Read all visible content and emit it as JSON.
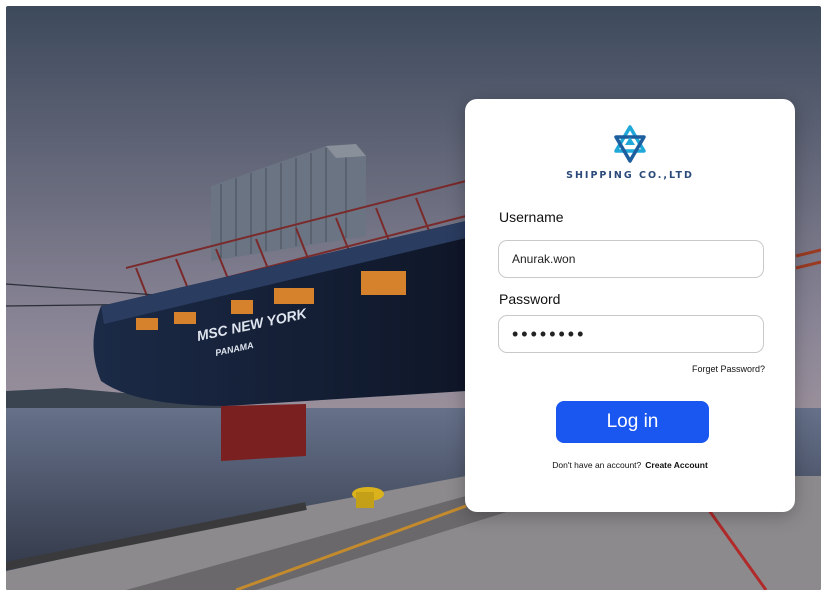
{
  "ship": {
    "name": "MSC NEW YORK",
    "port": "PANAMA"
  },
  "login": {
    "brand_name": "SHIPPING CO.,LTD",
    "username_label": "Username",
    "username_value": "Anurak.won",
    "password_label": "Password",
    "password_value": "••••••••",
    "forgot_label": "Forget Password?",
    "login_label": "Log in",
    "signup_prompt": "Don't have an account?",
    "create_account_label": "Create Account"
  },
  "colors": {
    "accent": "#1a56f0",
    "logo": "#1fa8d8",
    "brand": "#2b4a7a"
  }
}
